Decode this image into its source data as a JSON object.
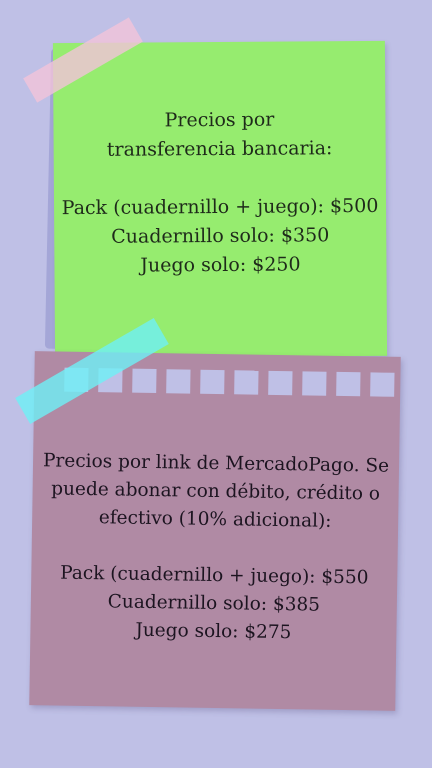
{
  "green_note": {
    "lines": [
      "Precios por",
      "transferencia bancaria:",
      "",
      "Pack (cuadernillo + juego): $500",
      "Cuadernillo solo: $350",
      "Juego solo: $250"
    ]
  },
  "purple_note": {
    "lines": [
      "Precios por link de MercadoPago. Se",
      "puede abonar con débito, crédito o",
      "efectivo (10% adicional):",
      "",
      "Pack (cuadernillo + juego): $550",
      "Cuadernillo solo: $385",
      "Juego solo: $275"
    ]
  },
  "colors": {
    "background": "#bfc0e6",
    "green_note": "#96ec6f",
    "purple_note": "#b08aa4",
    "pink_tape": "#f3c3d9",
    "cyan_tape": "#6ef0f6"
  }
}
